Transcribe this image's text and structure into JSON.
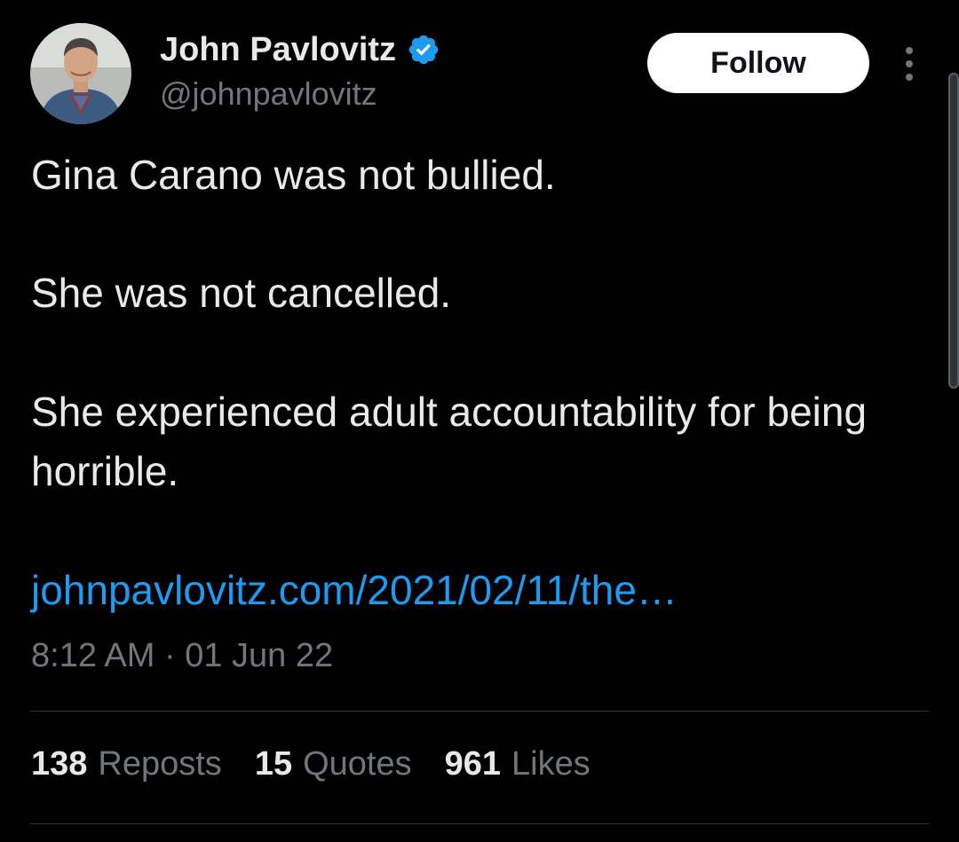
{
  "author": {
    "display_name": "John Pavlovitz",
    "handle": "@johnpavlovitz",
    "verified_color": "#1d9bf0"
  },
  "header": {
    "follow_label": "Follow",
    "more_icon": "more-vertical-icon"
  },
  "tweet": {
    "paragraphs": [
      "Gina Carano was not bullied.",
      "She was not cancelled.",
      "She experienced adult accountability for being horrible."
    ],
    "link_text": "johnpavlovitz.com/2021/02/11/the…",
    "timestamp": "8:12 AM · 01 Jun 22"
  },
  "stats": [
    {
      "count": "138",
      "label": "Reposts"
    },
    {
      "count": "15",
      "label": "Quotes"
    },
    {
      "count": "961",
      "label": "Likes"
    }
  ],
  "colors": {
    "background": "#000000",
    "text": "#e7e9ea",
    "secondary_text": "#71767b",
    "link": "#1d9bf0",
    "divider": "#2f3336"
  }
}
